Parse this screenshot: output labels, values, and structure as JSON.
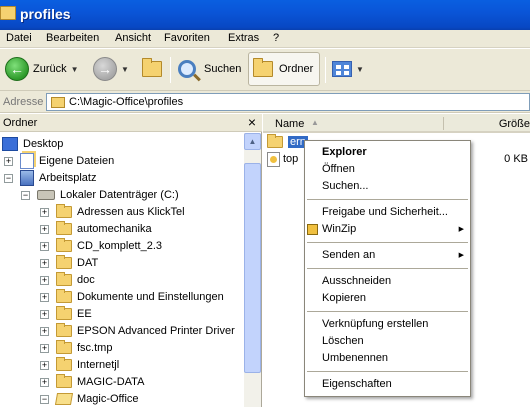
{
  "window": {
    "title": "profiles"
  },
  "menu": [
    "Datei",
    "Bearbeiten",
    "Ansicht",
    "Favoriten",
    "Extras",
    "?"
  ],
  "toolbar": {
    "back_label": "Zurück",
    "search_label": "Suchen",
    "folders_label": "Ordner"
  },
  "address": {
    "label": "Adresse",
    "value": "C:\\Magic-Office\\profiles"
  },
  "folders_pane": {
    "title": "Ordner",
    "close": "×",
    "items": [
      {
        "label": "Desktop",
        "icon": "desktop-icon"
      },
      {
        "label": "Eigene Dateien",
        "icon": "my-documents-icon",
        "expander": "+"
      },
      {
        "label": "Arbeitsplatz",
        "icon": "computer-icon",
        "expander": "−"
      },
      {
        "label": "Lokaler Datenträger (C:)",
        "icon": "drive-icon",
        "expander": "−"
      },
      {
        "label": "Adressen aus KlickTel",
        "icon": "folder-icon",
        "expander": "+"
      },
      {
        "label": "automechanika",
        "icon": "folder-icon",
        "expander": "+"
      },
      {
        "label": "CD_komplett_2.3",
        "icon": "folder-icon",
        "expander": "+"
      },
      {
        "label": "DAT",
        "icon": "folder-icon",
        "expander": "+"
      },
      {
        "label": "doc",
        "icon": "folder-icon",
        "expander": "+"
      },
      {
        "label": "Dokumente und Einstellungen",
        "icon": "folder-icon",
        "expander": "+"
      },
      {
        "label": "EE",
        "icon": "folder-icon",
        "expander": "+"
      },
      {
        "label": "EPSON Advanced Printer Driver",
        "icon": "folder-icon",
        "expander": "+"
      },
      {
        "label": "fsc.tmp",
        "icon": "folder-icon",
        "expander": "+"
      },
      {
        "label": "Internetjl",
        "icon": "folder-icon",
        "expander": "+"
      },
      {
        "label": "MAGIC-DATA",
        "icon": "folder-icon",
        "expander": "+"
      },
      {
        "label": "Magic-Office",
        "icon": "folder-open-icon",
        "expander": "−"
      }
    ]
  },
  "list": {
    "columns": {
      "name": "Name",
      "size": "Größe"
    },
    "rows": [
      {
        "name": "ern",
        "size": "",
        "selected": true
      },
      {
        "name": "top",
        "size": "0 KB",
        "selected": false
      }
    ]
  },
  "context_menu": {
    "groups": [
      [
        "Explorer",
        "Öffnen",
        "Suchen..."
      ],
      [
        "Freigabe und Sicherheit...",
        "WinZip"
      ],
      [
        "Senden an"
      ],
      [
        "Ausschneiden",
        "Kopieren"
      ],
      [
        "Verknüpfung erstellen",
        "Löschen",
        "Umbenennen"
      ],
      [
        "Eigenschaften"
      ]
    ]
  }
}
